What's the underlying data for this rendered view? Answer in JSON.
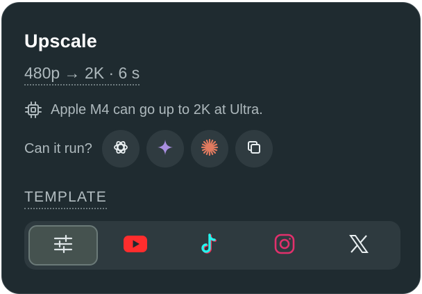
{
  "panel": {
    "title": "Upscale",
    "subtitle": "480p → 2K · 6 s",
    "hint": {
      "icon": "chip-icon",
      "text": "Apple M4 can go up to 2K at Ultra."
    },
    "run": {
      "label": "Can it run?",
      "buttons": [
        {
          "name": "chatgpt",
          "icon": "openai-icon"
        },
        {
          "name": "gemini",
          "icon": "sparkle-icon"
        },
        {
          "name": "claude",
          "icon": "claude-starburst-icon"
        },
        {
          "name": "copy",
          "icon": "copy-icon"
        }
      ]
    },
    "template": {
      "label": "TEMPLATE",
      "options": [
        {
          "name": "custom",
          "icon": "sliders-icon",
          "selected": true
        },
        {
          "name": "youtube",
          "icon": "youtube-icon",
          "selected": false
        },
        {
          "name": "tiktok",
          "icon": "tiktok-icon",
          "selected": false
        },
        {
          "name": "instagram",
          "icon": "instagram-icon",
          "selected": false
        },
        {
          "name": "x",
          "icon": "x-icon",
          "selected": false
        }
      ]
    }
  },
  "colors": {
    "panel_bg": "#1f2b30",
    "text_primary": "#ffffff",
    "text_secondary": "#aeb9bd",
    "gemini": "#a98fe0",
    "claude": "#e07a5f",
    "youtube": "#ff2d2d",
    "tiktok_cyan": "#25f4ee",
    "tiktok_red": "#fe2c55",
    "instagram": "#e1306c"
  }
}
